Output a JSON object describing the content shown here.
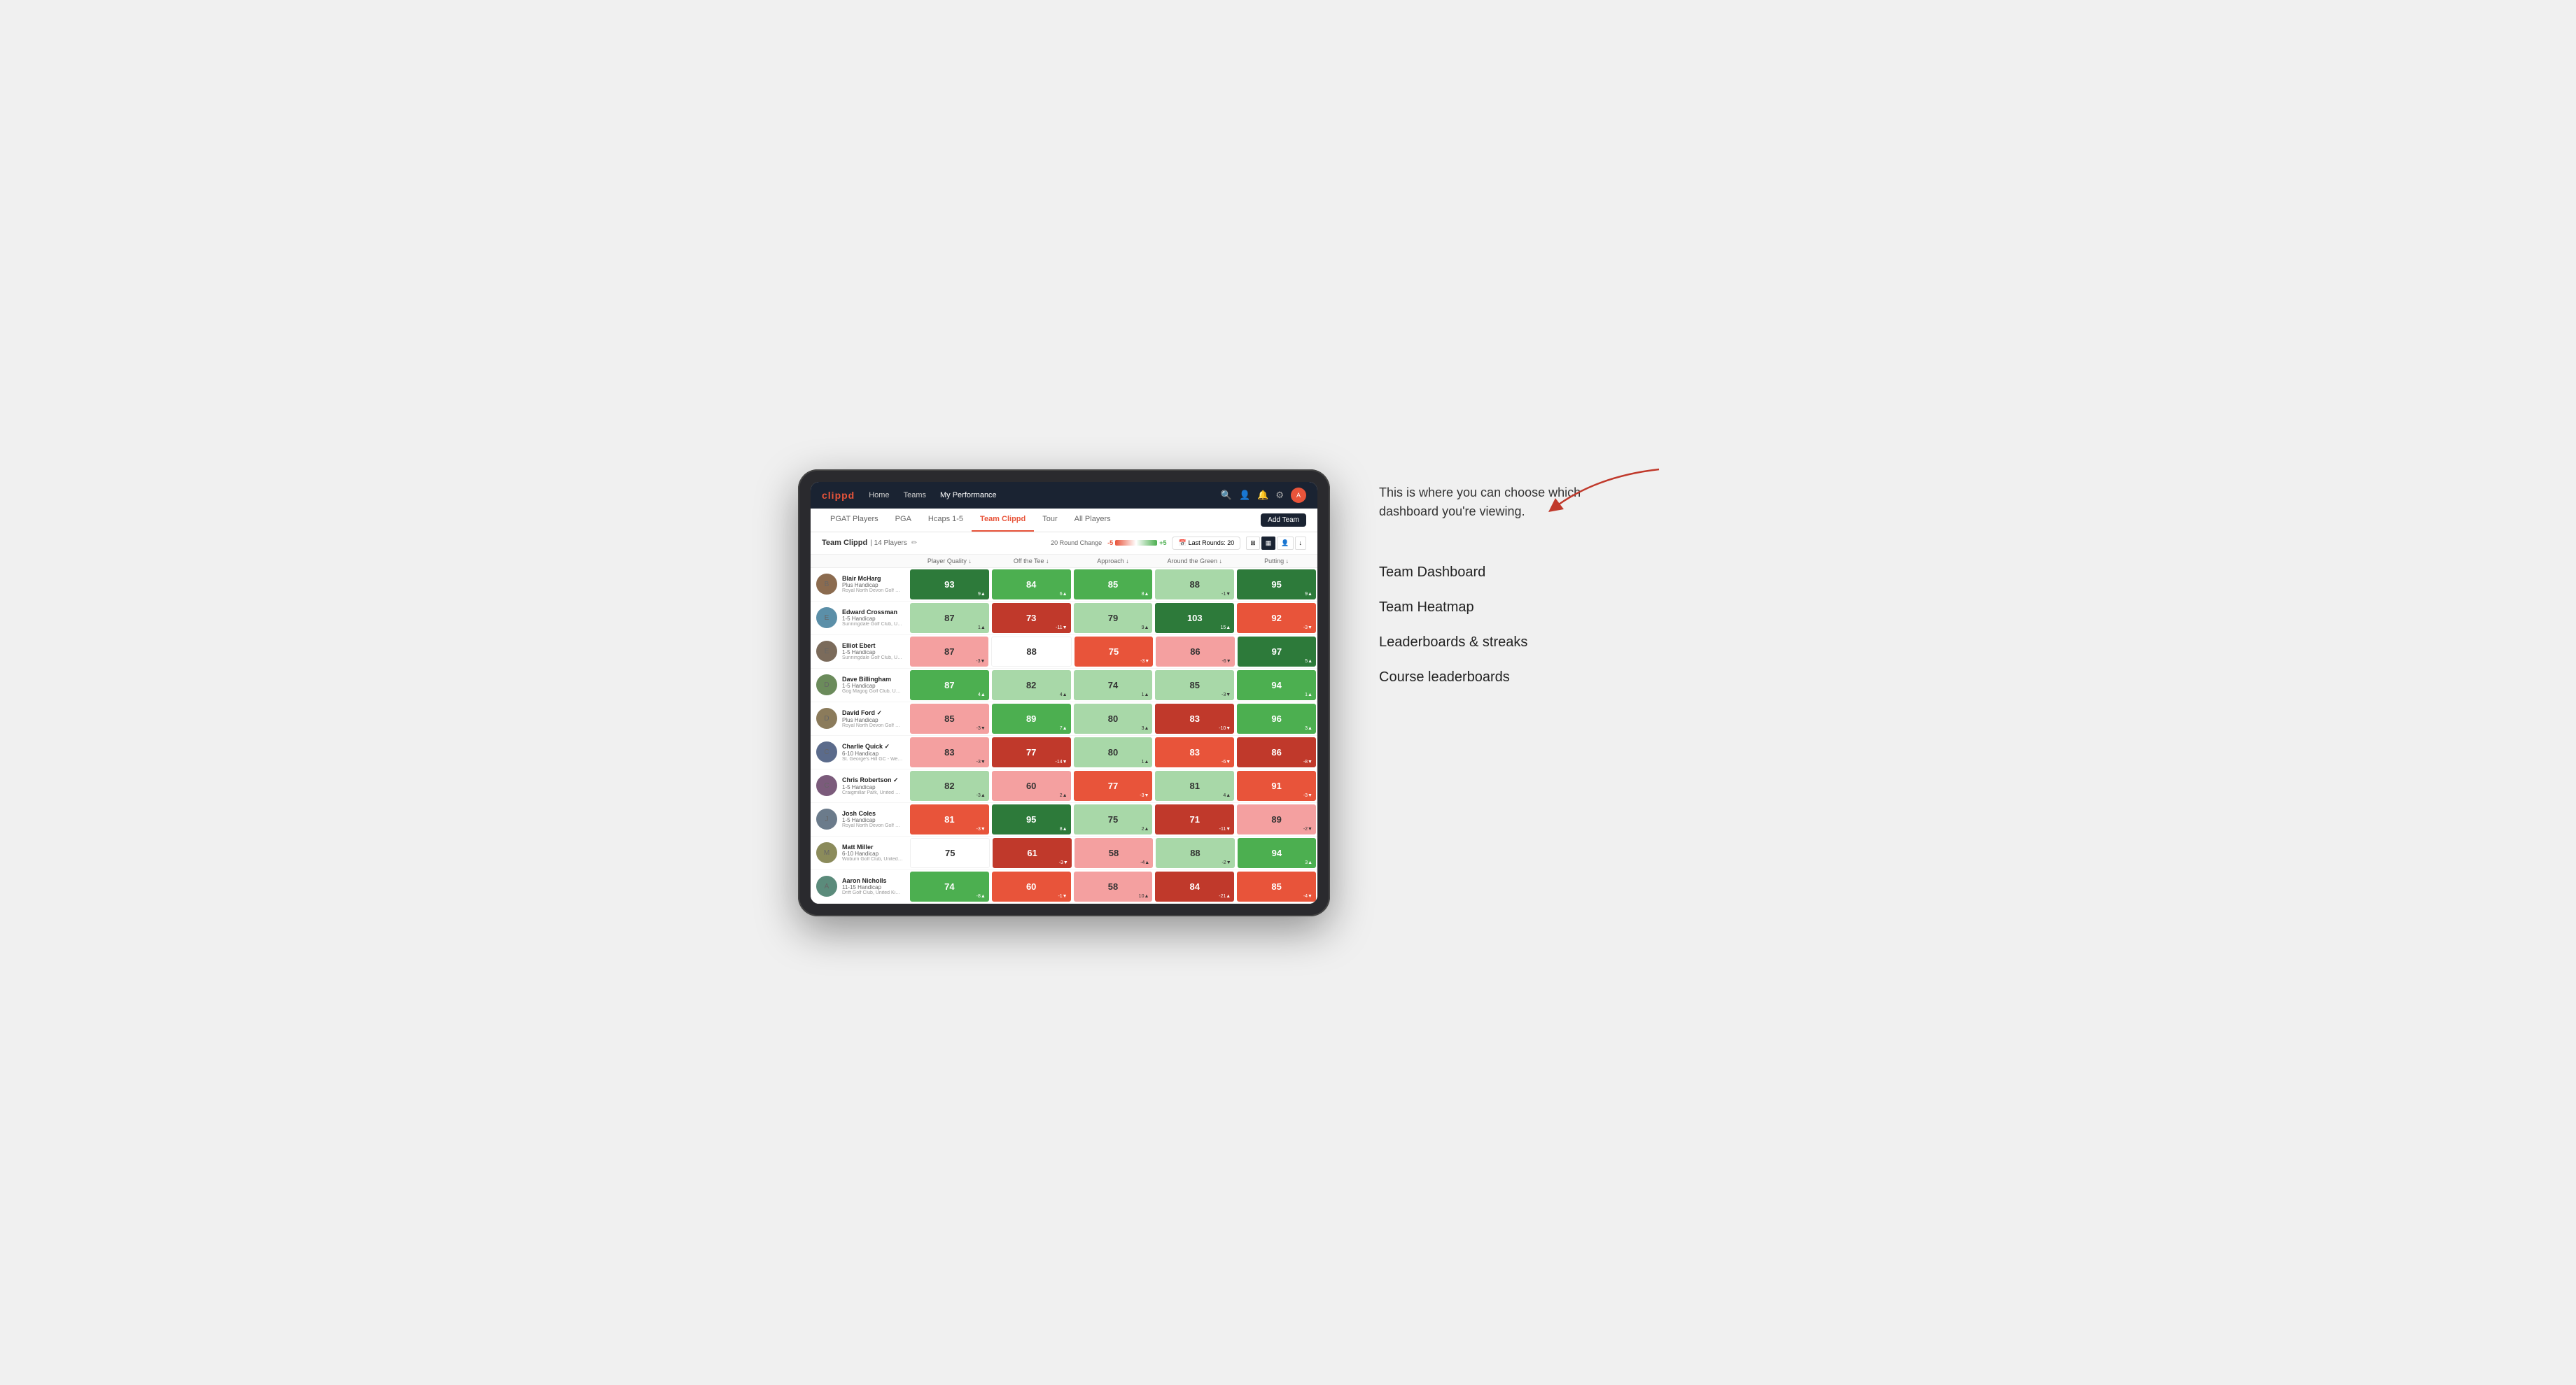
{
  "annotation": {
    "description": "This is where you can choose which dashboard you're viewing.",
    "options": [
      "Team Dashboard",
      "Team Heatmap",
      "Leaderboards & streaks",
      "Course leaderboards"
    ]
  },
  "nav": {
    "logo": "clippd",
    "links": [
      "Home",
      "Teams",
      "My Performance"
    ],
    "active_link": "My Performance"
  },
  "tabs": [
    "PGAT Players",
    "PGA",
    "Hcaps 1-5",
    "Team Clippd",
    "Tour",
    "All Players"
  ],
  "active_tab": "Team Clippd",
  "add_team_label": "Add Team",
  "team": {
    "name": "Team Clippd",
    "player_count": "14 Players",
    "round_change_label": "20 Round Change",
    "round_change_neg": "-5",
    "round_change_pos": "+5",
    "last_rounds_label": "Last Rounds: 20"
  },
  "col_headers": [
    "Player Quality ↓",
    "Off the Tee ↓",
    "Approach ↓",
    "Around the Green ↓",
    "Putting ↓"
  ],
  "players": [
    {
      "name": "Blair McHarg",
      "handicap": "Plus Handicap",
      "club": "Royal North Devon Golf Club, United Kingdom",
      "stats": [
        {
          "val": "93",
          "change": "9▲",
          "bg": "bg-dark-green"
        },
        {
          "val": "84",
          "change": "6▲",
          "bg": "bg-mid-green"
        },
        {
          "val": "85",
          "change": "8▲",
          "bg": "bg-mid-green"
        },
        {
          "val": "88",
          "change": "-1▼",
          "bg": "bg-light-green"
        },
        {
          "val": "95",
          "change": "9▲",
          "bg": "bg-dark-green"
        }
      ]
    },
    {
      "name": "Edward Crossman",
      "handicap": "1-5 Handicap",
      "club": "Sunningdale Golf Club, United Kingdom",
      "stats": [
        {
          "val": "87",
          "change": "1▲",
          "bg": "bg-light-green"
        },
        {
          "val": "73",
          "change": "-11▼",
          "bg": "bg-dark-red"
        },
        {
          "val": "79",
          "change": "9▲",
          "bg": "bg-light-green"
        },
        {
          "val": "103",
          "change": "15▲",
          "bg": "bg-dark-green"
        },
        {
          "val": "92",
          "change": "-3▼",
          "bg": "bg-mid-red"
        }
      ]
    },
    {
      "name": "Elliot Ebert",
      "handicap": "1-5 Handicap",
      "club": "Sunningdale Golf Club, United Kingdom",
      "stats": [
        {
          "val": "87",
          "change": "-3▼",
          "bg": "bg-light-red"
        },
        {
          "val": "88",
          "change": "",
          "bg": "bg-white"
        },
        {
          "val": "75",
          "change": "-3▼",
          "bg": "bg-mid-red"
        },
        {
          "val": "86",
          "change": "-6▼",
          "bg": "bg-light-red"
        },
        {
          "val": "97",
          "change": "5▲",
          "bg": "bg-dark-green"
        }
      ]
    },
    {
      "name": "Dave Billingham",
      "handicap": "1-5 Handicap",
      "club": "Gog Magog Golf Club, United Kingdom",
      "stats": [
        {
          "val": "87",
          "change": "4▲",
          "bg": "bg-mid-green"
        },
        {
          "val": "82",
          "change": "4▲",
          "bg": "bg-light-green"
        },
        {
          "val": "74",
          "change": "1▲",
          "bg": "bg-light-green"
        },
        {
          "val": "85",
          "change": "-3▼",
          "bg": "bg-light-green"
        },
        {
          "val": "94",
          "change": "1▲",
          "bg": "bg-mid-green"
        }
      ]
    },
    {
      "name": "David Ford ✓",
      "handicap": "Plus Handicap",
      "club": "Royal North Devon Golf Club, United Kingdom",
      "stats": [
        {
          "val": "85",
          "change": "-3▼",
          "bg": "bg-light-red"
        },
        {
          "val": "89",
          "change": "7▲",
          "bg": "bg-mid-green"
        },
        {
          "val": "80",
          "change": "3▲",
          "bg": "bg-light-green"
        },
        {
          "val": "83",
          "change": "-10▼",
          "bg": "bg-dark-red"
        },
        {
          "val": "96",
          "change": "3▲",
          "bg": "bg-mid-green"
        }
      ]
    },
    {
      "name": "Charlie Quick ✓",
      "handicap": "6-10 Handicap",
      "club": "St. George's Hill GC - Weybridge - Surrey, Uni...",
      "stats": [
        {
          "val": "83",
          "change": "-3▼",
          "bg": "bg-light-red"
        },
        {
          "val": "77",
          "change": "-14▼",
          "bg": "bg-dark-red"
        },
        {
          "val": "80",
          "change": "1▲",
          "bg": "bg-light-green"
        },
        {
          "val": "83",
          "change": "-6▼",
          "bg": "bg-mid-red"
        },
        {
          "val": "86",
          "change": "-8▼",
          "bg": "bg-dark-red"
        }
      ]
    },
    {
      "name": "Chris Robertson ✓",
      "handicap": "1-5 Handicap",
      "club": "Craigmillar Park, United Kingdom",
      "stats": [
        {
          "val": "82",
          "change": "-3▲",
          "bg": "bg-light-green"
        },
        {
          "val": "60",
          "change": "2▲",
          "bg": "bg-light-red"
        },
        {
          "val": "77",
          "change": "-3▼",
          "bg": "bg-mid-red"
        },
        {
          "val": "81",
          "change": "4▲",
          "bg": "bg-light-green"
        },
        {
          "val": "91",
          "change": "-3▼",
          "bg": "bg-mid-red"
        }
      ]
    },
    {
      "name": "Josh Coles",
      "handicap": "1-5 Handicap",
      "club": "Royal North Devon Golf Club, United Kingdom",
      "stats": [
        {
          "val": "81",
          "change": "-3▼",
          "bg": "bg-mid-red"
        },
        {
          "val": "95",
          "change": "8▲",
          "bg": "bg-dark-green"
        },
        {
          "val": "75",
          "change": "2▲",
          "bg": "bg-light-green"
        },
        {
          "val": "71",
          "change": "-11▼",
          "bg": "bg-dark-red"
        },
        {
          "val": "89",
          "change": "-2▼",
          "bg": "bg-light-red"
        }
      ]
    },
    {
      "name": "Matt Miller",
      "handicap": "6-10 Handicap",
      "club": "Woburn Golf Club, United Kingdom",
      "stats": [
        {
          "val": "75",
          "change": "",
          "bg": "bg-white"
        },
        {
          "val": "61",
          "change": "-3▼",
          "bg": "bg-dark-red"
        },
        {
          "val": "58",
          "change": "-4▲",
          "bg": "bg-light-red"
        },
        {
          "val": "88",
          "change": "-2▼",
          "bg": "bg-light-green"
        },
        {
          "val": "94",
          "change": "3▲",
          "bg": "bg-mid-green"
        }
      ]
    },
    {
      "name": "Aaron Nicholls",
      "handicap": "11-15 Handicap",
      "club": "Drift Golf Club, United Kingdom",
      "stats": [
        {
          "val": "74",
          "change": "-8▲",
          "bg": "bg-mid-green"
        },
        {
          "val": "60",
          "change": "-1▼",
          "bg": "bg-mid-red"
        },
        {
          "val": "58",
          "change": "10▲",
          "bg": "bg-light-red"
        },
        {
          "val": "84",
          "change": "-21▲",
          "bg": "bg-dark-red"
        },
        {
          "val": "85",
          "change": "-4▼",
          "bg": "bg-mid-red"
        }
      ]
    }
  ]
}
